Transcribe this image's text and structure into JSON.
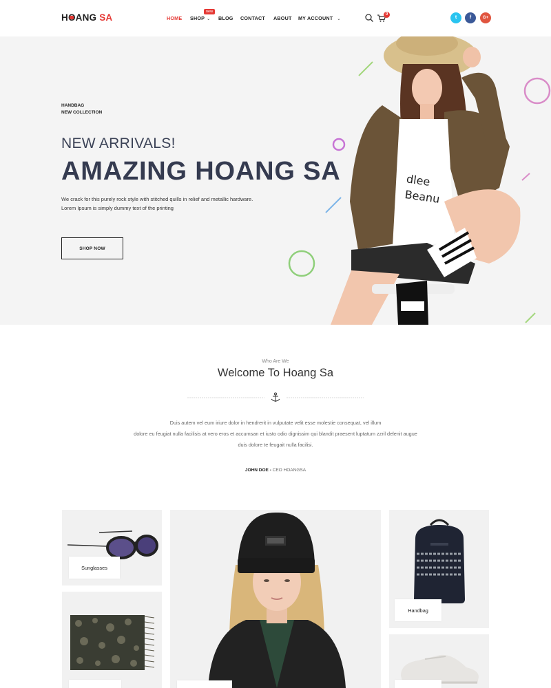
{
  "brand": {
    "logo_part1": "H",
    "logo_part2": "ANG ",
    "logo_part3": "SA",
    "logo_o": "O"
  },
  "nav": {
    "home": "HOME",
    "shop": "SHOP",
    "shop_badge": "new",
    "blog": "BLOG",
    "contact": "CONTACT",
    "about": "ABOUT",
    "my_account": "MY ACCOUNT",
    "cart_count": "0"
  },
  "social": {
    "twitter": "t",
    "facebook": "f",
    "google": "G+"
  },
  "hero": {
    "eyebrow_line1": "HANDBAG",
    "eyebrow_line2": "NEW COLLECTION",
    "subtitle": "NEW ARRIVALS!",
    "title": "AMAZING HOANG SA",
    "desc_line1": "We crack for this purely rock style with stitched quills in relief and metallic hardware.",
    "desc_line2": "Lorem Ipsum is simply dummy text of the printing",
    "cta": "SHOP NOW"
  },
  "about": {
    "eyebrow": "Who Are We",
    "title": "Welcome To Hoang Sa",
    "text_line1": "Duis autem vel eum iriure dolor in hendrerit in vulputate velit esse molestie consequat, vel illum",
    "text_line2": "dolore eu feugiat nulla facilisis at vero eros et accumsan et iusto odio dignissim qui blandit praesent luptatum zzril delenit augue",
    "text_line3": "duis dolore te feugait nulla facilisi.",
    "author": "JOHN DOE",
    "author_sep": " - ",
    "author_role": "CEO HOANGSA"
  },
  "products": {
    "sunglasses": "Sunglasses",
    "handbag": "Handbag"
  },
  "colors": {
    "accent": "#e53935",
    "heading": "#353b50",
    "twitter": "#29c4f0",
    "facebook": "#3b5998",
    "google": "#e0553f"
  }
}
